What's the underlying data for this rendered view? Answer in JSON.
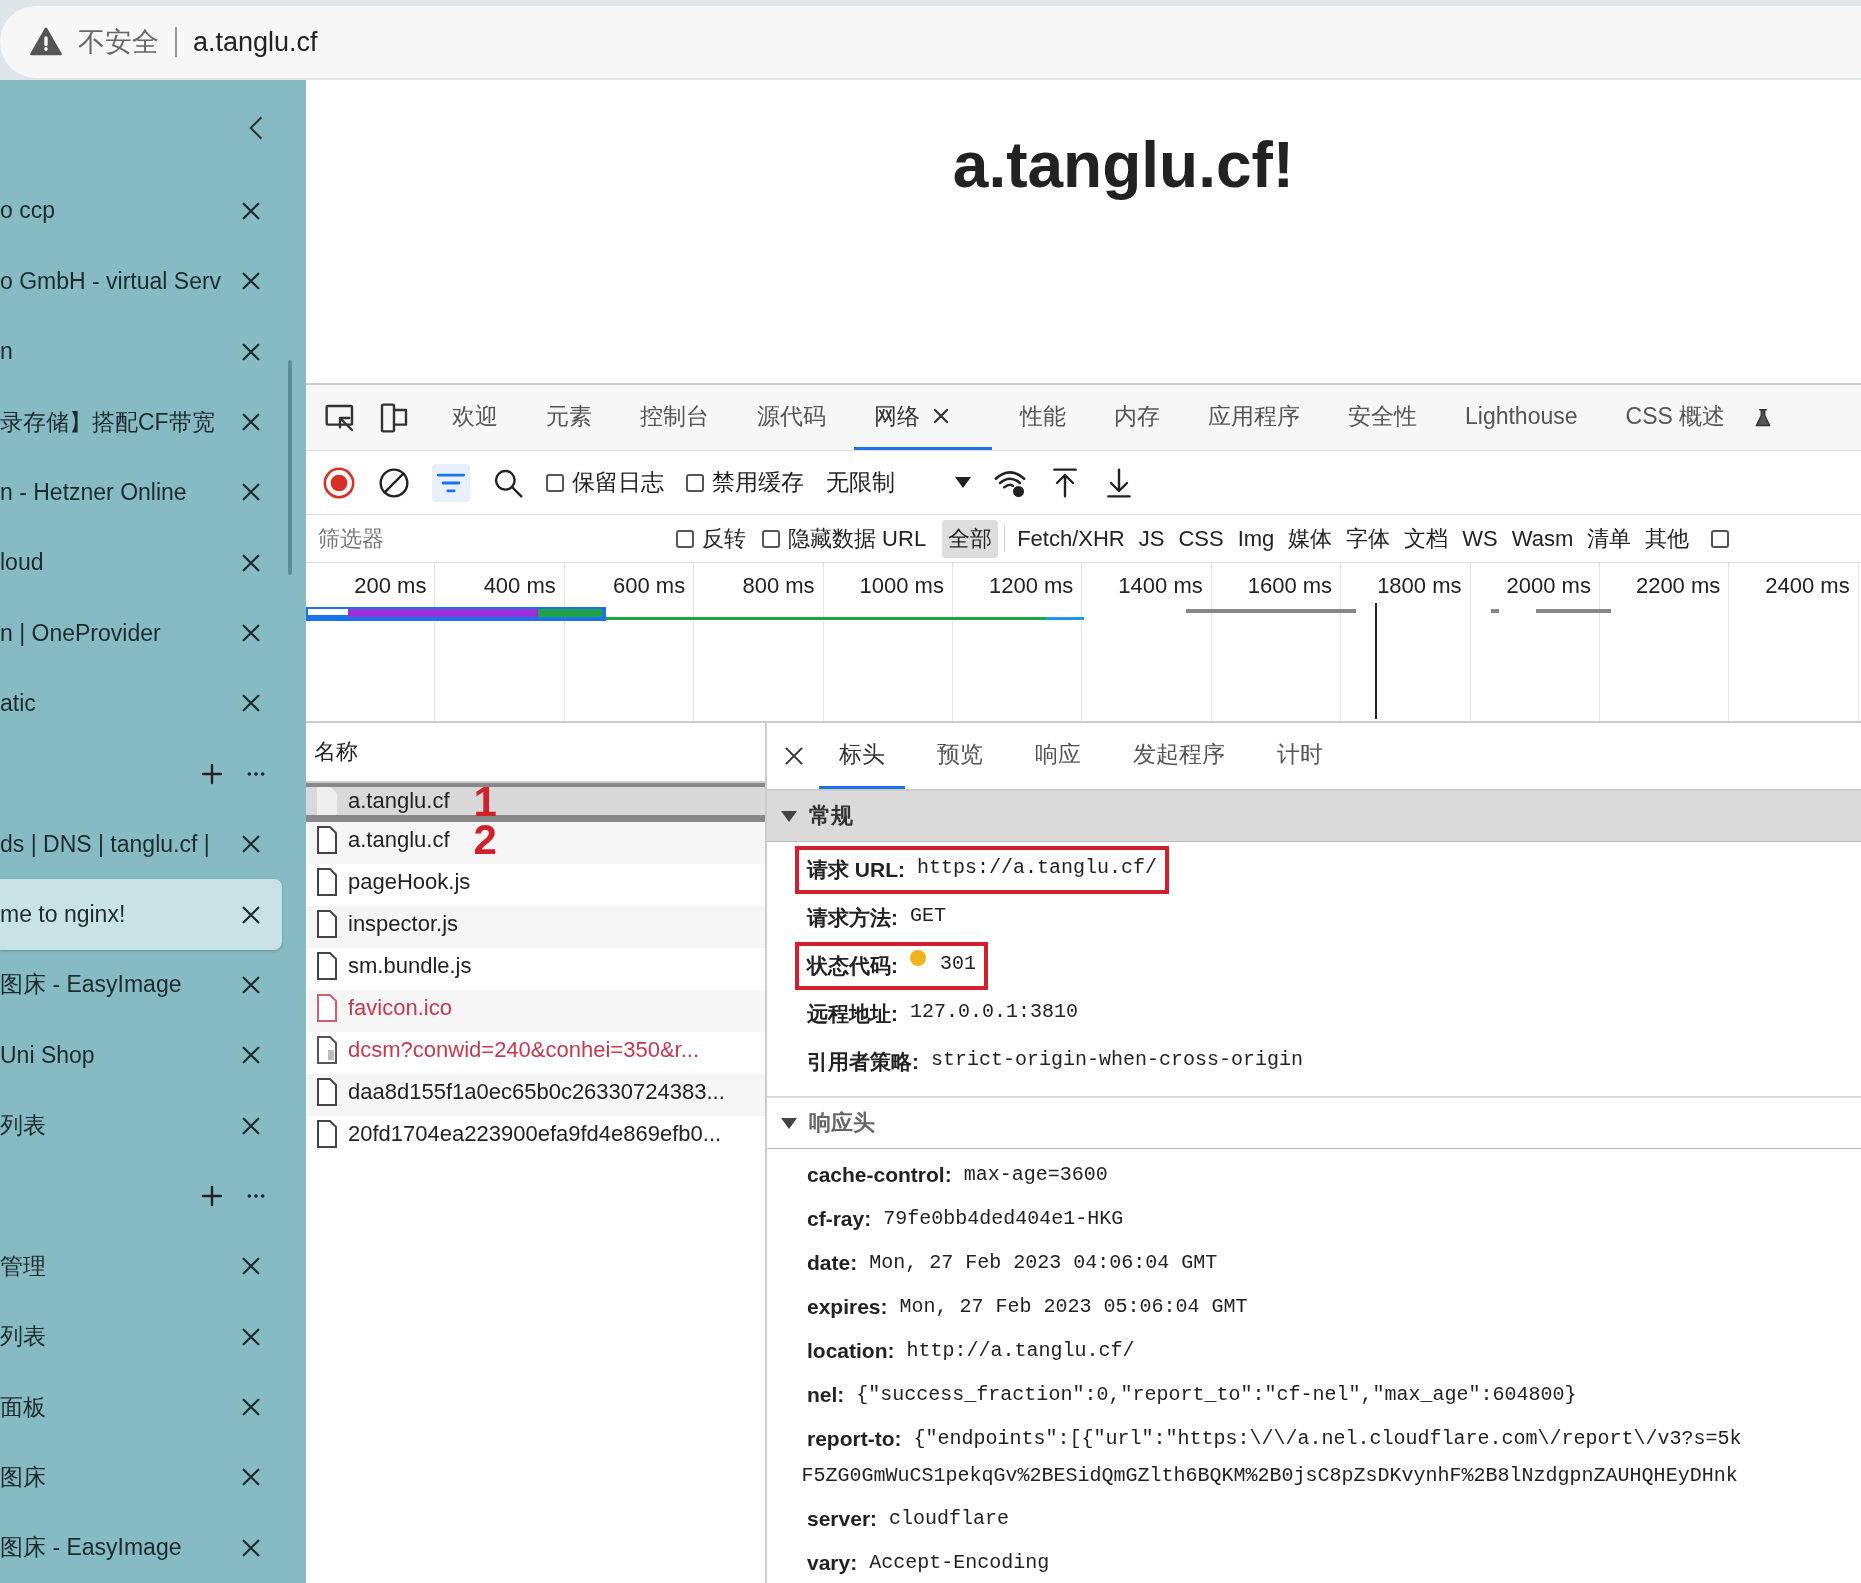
{
  "address_bar": {
    "security_label": "不安全",
    "url": "a.tanglu.cf"
  },
  "sidebar": {
    "items": [
      {
        "kind": "tab",
        "title": "o ccp",
        "selected": false
      },
      {
        "kind": "tab",
        "title": "o GmbH - virtual Serv",
        "selected": false
      },
      {
        "kind": "tab",
        "title": "n",
        "selected": false
      },
      {
        "kind": "tab",
        "title": "录存储】搭配CF带宽",
        "selected": false
      },
      {
        "kind": "tab",
        "title": "n - Hetzner Online",
        "selected": false
      },
      {
        "kind": "tab",
        "title": "loud",
        "selected": false
      },
      {
        "kind": "tab",
        "title": "n | OneProvider",
        "selected": false
      },
      {
        "kind": "tab",
        "title": "atic",
        "selected": false
      },
      {
        "kind": "actions"
      },
      {
        "kind": "tab",
        "title": "ds | DNS | tanglu.cf |",
        "selected": false
      },
      {
        "kind": "tab",
        "title": "me to nginx!",
        "selected": true
      },
      {
        "kind": "tab",
        "title": "图床 - EasyImage",
        "selected": false
      },
      {
        "kind": "tab",
        "title": "Uni Shop",
        "selected": false
      },
      {
        "kind": "tab",
        "title": "列表",
        "selected": false
      },
      {
        "kind": "actions"
      },
      {
        "kind": "tab",
        "title": "管理",
        "selected": false
      },
      {
        "kind": "tab",
        "title": "列表",
        "selected": false
      },
      {
        "kind": "tab",
        "title": "面板",
        "selected": false
      },
      {
        "kind": "tab",
        "title": "图床",
        "selected": false
      },
      {
        "kind": "tab",
        "title": "图床 - EasyImage",
        "selected": false
      }
    ]
  },
  "page": {
    "heading": "a.tanglu.cf!"
  },
  "devtools": {
    "tabs": [
      {
        "label": "欢迎",
        "selected": false
      },
      {
        "label": "元素",
        "selected": false
      },
      {
        "label": "控制台",
        "selected": false
      },
      {
        "label": "源代码",
        "selected": false
      },
      {
        "label": "网络",
        "selected": true
      },
      {
        "label": "性能",
        "selected": false
      },
      {
        "label": "内存",
        "selected": false
      },
      {
        "label": "应用程序",
        "selected": false
      },
      {
        "label": "安全性",
        "selected": false
      },
      {
        "label": "Lighthouse",
        "selected": false
      },
      {
        "label": "CSS 概述",
        "selected": false
      }
    ],
    "toolbar": {
      "checkboxes": [
        {
          "label": "保留日志",
          "checked": false
        },
        {
          "label": "禁用缓存",
          "checked": false
        }
      ],
      "throttling": "无限制"
    },
    "filter": {
      "placeholder": "筛选器",
      "checkboxes": [
        {
          "label": "反转",
          "checked": false
        },
        {
          "label": "隐藏数据 URL",
          "checked": false
        }
      ],
      "types": [
        {
          "label": "全部",
          "selected": true
        },
        {
          "label": "Fetch/XHR",
          "selected": false
        },
        {
          "label": "JS",
          "selected": false
        },
        {
          "label": "CSS",
          "selected": false
        },
        {
          "label": "Img",
          "selected": false
        },
        {
          "label": "媒体",
          "selected": false
        },
        {
          "label": "字体",
          "selected": false
        },
        {
          "label": "文档",
          "selected": false
        },
        {
          "label": "WS",
          "selected": false
        },
        {
          "label": "Wasm",
          "selected": false
        },
        {
          "label": "清单",
          "selected": false
        },
        {
          "label": "其他",
          "selected": false
        }
      ],
      "trailing_checkbox": {
        "checked": false
      }
    },
    "timeline": {
      "ticks": [
        "200 ms",
        "400 ms",
        "600 ms",
        "800 ms",
        "1000 ms",
        "1200 ms",
        "1400 ms",
        "1600 ms",
        "1800 ms",
        "2000 ms",
        "2200 ms",
        "2400 ms"
      ]
    },
    "requests": {
      "column": "名称",
      "rows": [
        {
          "name": "a.tanglu.cf",
          "kind": "document",
          "selected": true,
          "failed": false,
          "annotation": "1"
        },
        {
          "name": "a.tanglu.cf",
          "kind": "document",
          "selected": false,
          "failed": false,
          "annotation": "2"
        },
        {
          "name": "pageHook.js",
          "kind": "document",
          "selected": false,
          "failed": false
        },
        {
          "name": "inspector.js",
          "kind": "document",
          "selected": false,
          "failed": false
        },
        {
          "name": "sm.bundle.js",
          "kind": "document",
          "selected": false,
          "failed": false
        },
        {
          "name": "favicon.ico",
          "kind": "document",
          "selected": false,
          "failed": true
        },
        {
          "name": "dcsm?conwid=240&conhei=350&r...",
          "kind": "image",
          "selected": false,
          "failed": true
        },
        {
          "name": "daa8d155f1a0ec65b0c26330724383...",
          "kind": "document",
          "selected": false,
          "failed": false
        },
        {
          "name": "20fd1704ea223900efa9fd4e869efb0...",
          "kind": "document",
          "selected": false,
          "failed": false
        }
      ]
    },
    "details": {
      "tabs": [
        {
          "label": "标头",
          "selected": true
        },
        {
          "label": "预览",
          "selected": false
        },
        {
          "label": "响应",
          "selected": false
        },
        {
          "label": "发起程序",
          "selected": false
        },
        {
          "label": "计时",
          "selected": false
        }
      ],
      "sections": [
        {
          "title": "常规",
          "expanded": true,
          "shaded": true,
          "rows": [
            {
              "name": "请求 URL:",
              "value": [
                "https://a.tanglu.cf/"
              ],
              "highlighted": true
            },
            {
              "name": "请求方法:",
              "value": [
                "GET"
              ],
              "highlighted": false
            },
            {
              "name": "状态代码:",
              "value": [
                "301"
              ],
              "highlighted": true,
              "kind": "status"
            },
            {
              "name": "远程地址:",
              "value": [
                "127.0.0.1:3810"
              ],
              "highlighted": false
            },
            {
              "name": "引用者策略:",
              "value": [
                "strict-origin-when-cross-origin"
              ],
              "highlighted": false
            }
          ]
        },
        {
          "title": "响应头",
          "expanded": true,
          "shaded": false,
          "rows": [
            {
              "name": "cache-control:",
              "value": [
                "max-age=3600"
              ],
              "highlighted": false
            },
            {
              "name": "cf-ray:",
              "value": [
                "79fe0bb4ded404e1-HKG"
              ],
              "highlighted": false
            },
            {
              "name": "date:",
              "value": [
                "Mon, 27 Feb 2023 04:06:04 GMT"
              ],
              "highlighted": false
            },
            {
              "name": "expires:",
              "value": [
                "Mon, 27 Feb 2023 05:06:04 GMT"
              ],
              "highlighted": false
            },
            {
              "name": "location:",
              "value": [
                "http://a.tanglu.cf/"
              ],
              "highlighted": false
            },
            {
              "name": "nel:",
              "value": [
                "{\"success_fraction\":0,\"report_to\":\"cf-nel\",\"max_age\":604800}"
              ],
              "highlighted": false
            },
            {
              "name": "report-to:",
              "value": [
                "{\"endpoints\":[{\"url\":\"https:\\/\\/a.nel.cloudflare.com\\/report\\/v3?s=5k",
                "F5ZG0GmWuCS1pekqGv%2BESidQmGZlth6BQKM%2B0jsC8pZsDKvynhF%2B8lNzdgpnZAUHQHEyDHnk"
              ],
              "highlighted": false
            },
            {
              "name": "server:",
              "value": [
                "cloudflare"
              ],
              "highlighted": false
            },
            {
              "name": "vary:",
              "value": [
                "Accept-Encoding"
              ],
              "highlighted": false
            }
          ]
        }
      ]
    }
  }
}
